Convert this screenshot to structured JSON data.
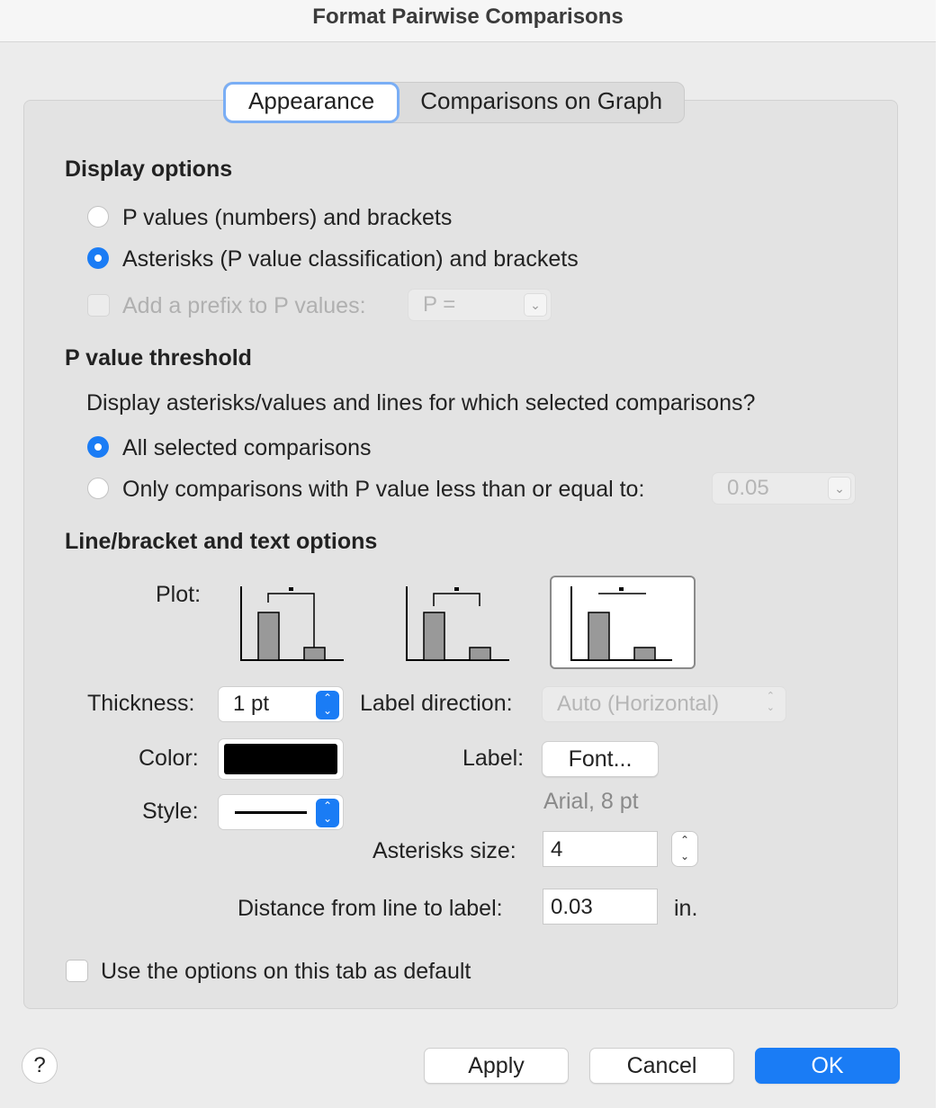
{
  "window": {
    "title": "Format Pairwise Comparisons"
  },
  "tabs": [
    {
      "label": "Appearance",
      "active": true
    },
    {
      "label": "Comparisons on Graph",
      "active": false
    }
  ],
  "display_options": {
    "title": "Display options",
    "opt_pvalues": "P values (numbers) and brackets",
    "opt_asterisks": "Asterisks (P value classification) and brackets",
    "selected": "asterisks",
    "prefix_label": "Add a prefix to P values:",
    "prefix_value": "P ="
  },
  "threshold": {
    "title": "P value threshold",
    "question": "Display asterisks/values and lines for which selected comparisons?",
    "opt_all": "All selected comparisons",
    "opt_only": "Only comparisons with P value less than or equal to:",
    "selected": "all",
    "value": "0.05"
  },
  "line_text": {
    "title": "Line/bracket and text options",
    "plot_label": "Plot:",
    "plot_selected_index": 2,
    "thickness_label": "Thickness:",
    "thickness_value": "1 pt",
    "color_label": "Color:",
    "color_value": "#000000",
    "style_label": "Style:",
    "label_direction_label": "Label direction:",
    "label_direction_value": "Auto (Horizontal)",
    "label_label": "Label:",
    "font_button": "Font...",
    "font_desc": "Arial, 8 pt",
    "asterisks_size_label": "Asterisks size:",
    "asterisks_size_value": "4",
    "distance_label": "Distance from line to label:",
    "distance_value": "0.03",
    "distance_unit": "in."
  },
  "default_checkbox": "Use the options on this tab as default",
  "footer": {
    "help": "?",
    "apply": "Apply",
    "cancel": "Cancel",
    "ok": "OK"
  },
  "colors": {
    "accent": "#1a7cf5",
    "panel": "#e3e3e3",
    "window": "#ececec"
  },
  "icons": [
    "chevron-down-icon",
    "up-down-chevrons-icon",
    "bar-bracket-plot-icon",
    "help-icon"
  ]
}
